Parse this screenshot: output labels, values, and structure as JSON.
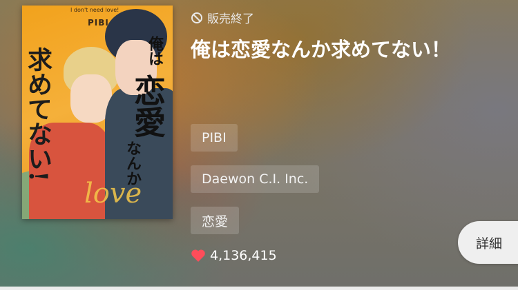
{
  "status": {
    "icon": "prohibited-icon",
    "label": "販売終了"
  },
  "title": "俺は恋愛なんか求めてない！",
  "cover": {
    "english_title": "I don't need love!",
    "author": "PIBI",
    "vertical_left": "求めてない!",
    "vertical_right_top": "俺は",
    "vertical_right_main": "恋愛",
    "vertical_right_bottom": "なんか",
    "script_word": "love"
  },
  "tags": {
    "author": "PIBI",
    "publisher": "Daewon C.I. Inc.",
    "genre": "恋愛"
  },
  "likes": {
    "icon": "heart-icon",
    "count": "4,136,415",
    "color": "#ff4d5a"
  },
  "detail_button": {
    "label": "詳細"
  }
}
